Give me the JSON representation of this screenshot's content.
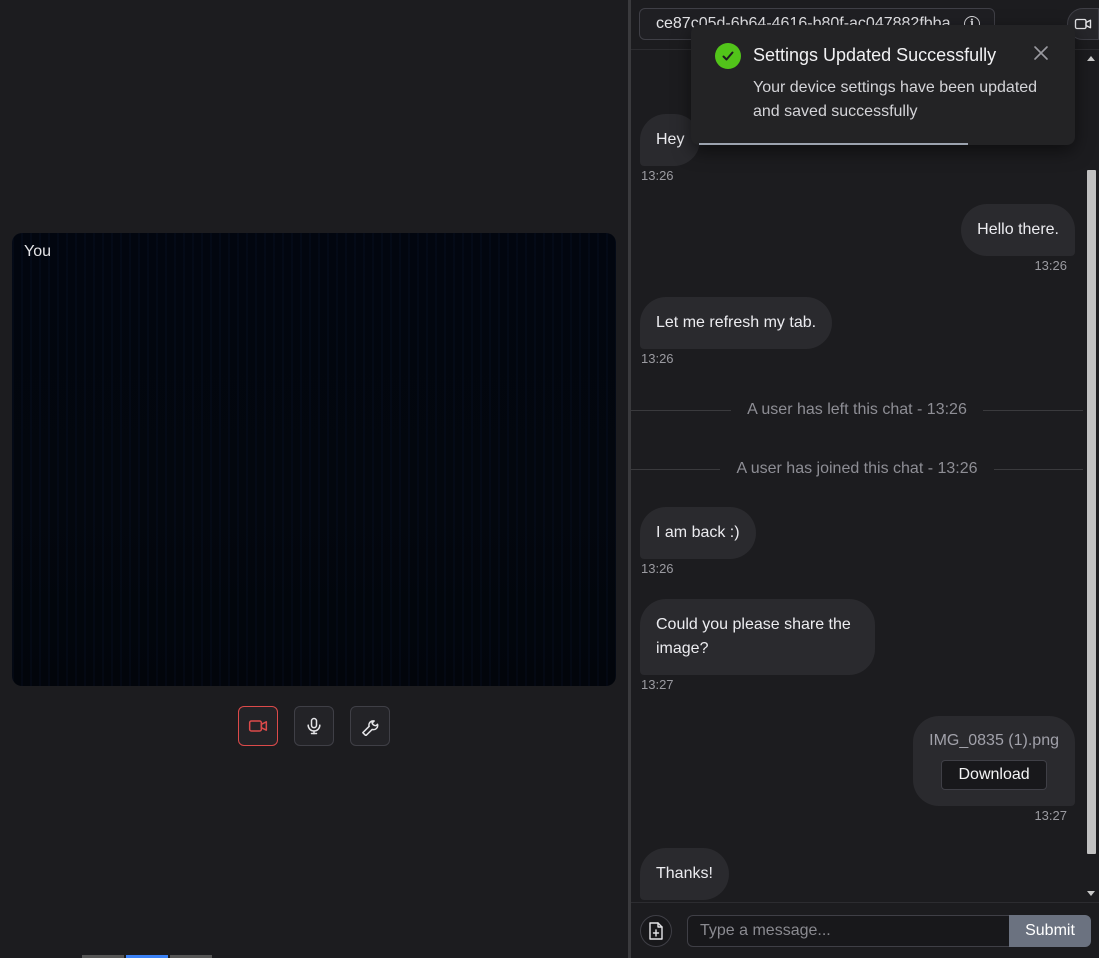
{
  "video": {
    "self_label": "You",
    "controls": [
      {
        "name": "camera-toggle-button",
        "icon": "video-camera-icon",
        "active": true
      },
      {
        "name": "microphone-toggle-button",
        "icon": "microphone-icon",
        "active": false
      },
      {
        "name": "settings-button",
        "icon": "wrench-icon",
        "active": false
      }
    ]
  },
  "chat": {
    "room_id": "ce87c05d-6b64-4616-b80f-ac047882fbba",
    "messages": [
      {
        "type": "in",
        "text": "Hey",
        "time": "13:26"
      },
      {
        "type": "out",
        "text": "Hello there.",
        "time": "13:26"
      },
      {
        "type": "in",
        "text": "Let me refresh my tab.",
        "time": "13:26"
      },
      {
        "type": "system",
        "text": "A user has left this chat - 13:26"
      },
      {
        "type": "system",
        "text": "A user has joined this chat - 13:26"
      },
      {
        "type": "in",
        "text": "I am back :)",
        "time": "13:26"
      },
      {
        "type": "in",
        "text": "Could you please share the image?",
        "time": "13:27"
      },
      {
        "type": "file",
        "filename": "IMG_0835 (1).png",
        "button": "Download",
        "time": "13:27"
      },
      {
        "type": "in",
        "text": "Thanks!"
      }
    ],
    "composer": {
      "placeholder": "Type a message...",
      "submit_label": "Submit"
    }
  },
  "toast": {
    "title": "Settings Updated Successfully",
    "body": "Your device settings have been updated and saved successfully",
    "icon": "check-circle-icon",
    "progress": 0.7
  },
  "colors": {
    "background": "#1c1c1f",
    "bubble": "#2a2a2e",
    "danger": "#dc4a4a",
    "success": "#52c41a",
    "submit": "#6b7280"
  }
}
